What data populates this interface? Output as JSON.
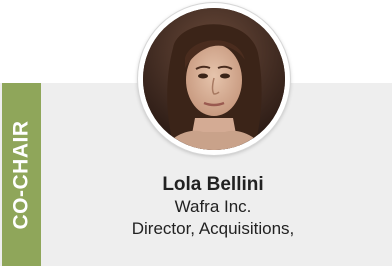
{
  "tag": {
    "label": "CO-CHAIR",
    "color": "#8fa65a"
  },
  "person": {
    "avatar_icon": "portrait-photo",
    "name": "Lola Bellini",
    "company": "Wafra Inc.",
    "title": "Director, Acquisitions,"
  }
}
